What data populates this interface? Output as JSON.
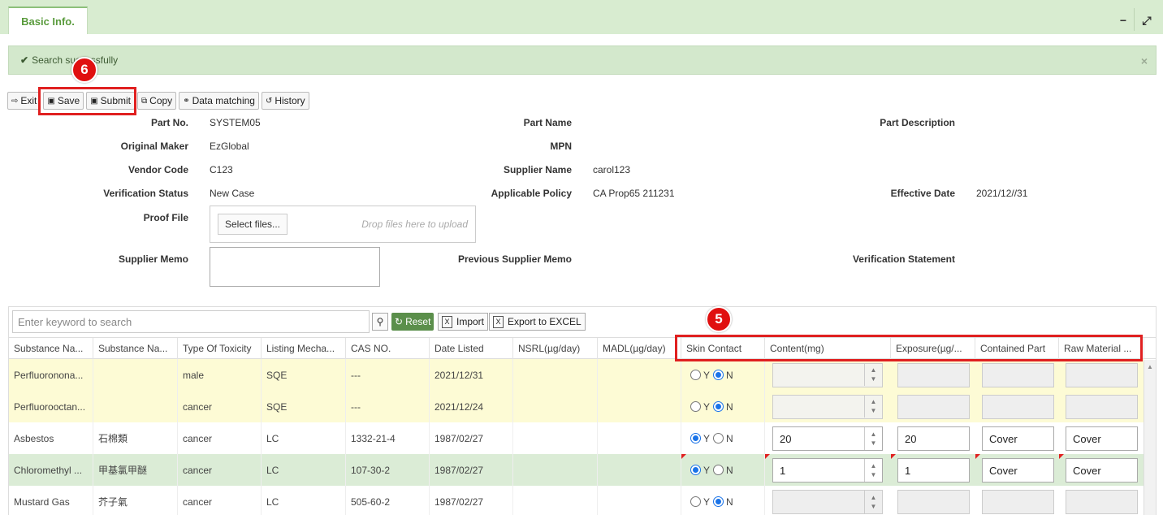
{
  "tab": {
    "label": "Basic Info."
  },
  "window": {
    "minimize": "−",
    "expand": "⤢"
  },
  "alert": {
    "message": "Search successfully",
    "close": "×"
  },
  "toolbar": {
    "exit": "Exit",
    "save": "Save",
    "submit": "Submit",
    "copy": "Copy",
    "data_matching": "Data matching",
    "history": "History"
  },
  "annotations": {
    "six": "6",
    "five": "5"
  },
  "form": {
    "part_no": {
      "label": "Part No.",
      "value": "SYSTEM05"
    },
    "part_name": {
      "label": "Part Name",
      "value": ""
    },
    "part_description": {
      "label": "Part Description",
      "value": ""
    },
    "original_maker": {
      "label": "Original Maker",
      "value": "EzGlobal"
    },
    "mpn": {
      "label": "MPN",
      "value": ""
    },
    "vendor_code": {
      "label": "Vendor Code",
      "value": "C123"
    },
    "supplier_name": {
      "label": "Supplier Name",
      "value": "carol123"
    },
    "verification_status": {
      "label": "Verification Status",
      "value": "New Case"
    },
    "applicable_policy": {
      "label": "Applicable Policy",
      "value": "CA Prop65 211231"
    },
    "effective_date": {
      "label": "Effective Date",
      "value": "2021/12//31"
    },
    "proof_file": {
      "label": "Proof File",
      "select_files": "Select files...",
      "drop_hint": "Drop files here to upload"
    },
    "supplier_memo": {
      "label": "Supplier Memo"
    },
    "previous_supplier_memo": {
      "label": "Previous Supplier Memo"
    },
    "verification_statement": {
      "label": "Verification Statement"
    }
  },
  "grid": {
    "search_placeholder": "Enter keyword to search",
    "reset": "Reset",
    "import": "Import",
    "export": "Export to EXCEL",
    "columns": [
      "Substance Na...",
      "Substance Na...",
      "Type Of Toxicity",
      "Listing Mecha...",
      "CAS NO.",
      "Date Listed",
      "NSRL(µg/day)",
      "MADL(µg/day)",
      "Skin Contact",
      "Content(mg)",
      "Exposure(µg/...",
      "Contained Part",
      "Raw Material ..."
    ],
    "radio_y": "Y",
    "radio_n": "N",
    "rows": [
      {
        "name": "Perfluoronona...",
        "name_local": "",
        "toxicity": "male",
        "mechanism": "SQE",
        "cas": "---",
        "date": "2021/12/31",
        "nsrl": "",
        "madl": "",
        "skin": "N",
        "content": "",
        "exposure": "",
        "contained": "",
        "raw": ""
      },
      {
        "name": "Perfluorooctan...",
        "name_local": "",
        "toxicity": "cancer",
        "mechanism": "SQE",
        "cas": "---",
        "date": "2021/12/24",
        "nsrl": "",
        "madl": "",
        "skin": "N",
        "content": "",
        "exposure": "",
        "contained": "",
        "raw": ""
      },
      {
        "name": "Asbestos",
        "name_local": "石棉類",
        "toxicity": "cancer",
        "mechanism": "LC",
        "cas": "1332-21-4",
        "date": "1987/02/27",
        "nsrl": "",
        "madl": "",
        "skin": "Y",
        "content": "20",
        "exposure": "20",
        "contained": "Cover",
        "raw": "Cover"
      },
      {
        "name": "Chloromethyl ...",
        "name_local": "甲基氯甲醚",
        "toxicity": "cancer",
        "mechanism": "LC",
        "cas": "107-30-2",
        "date": "1987/02/27",
        "nsrl": "",
        "madl": "",
        "skin": "Y",
        "content": "1",
        "exposure": "1",
        "contained": "Cover",
        "raw": "Cover"
      },
      {
        "name": "Mustard Gas",
        "name_local": "芥子氣",
        "toxicity": "cancer",
        "mechanism": "LC",
        "cas": "505-60-2",
        "date": "1987/02/27",
        "nsrl": "",
        "madl": "",
        "skin": "N",
        "content": "",
        "exposure": "",
        "contained": "",
        "raw": ""
      }
    ]
  }
}
